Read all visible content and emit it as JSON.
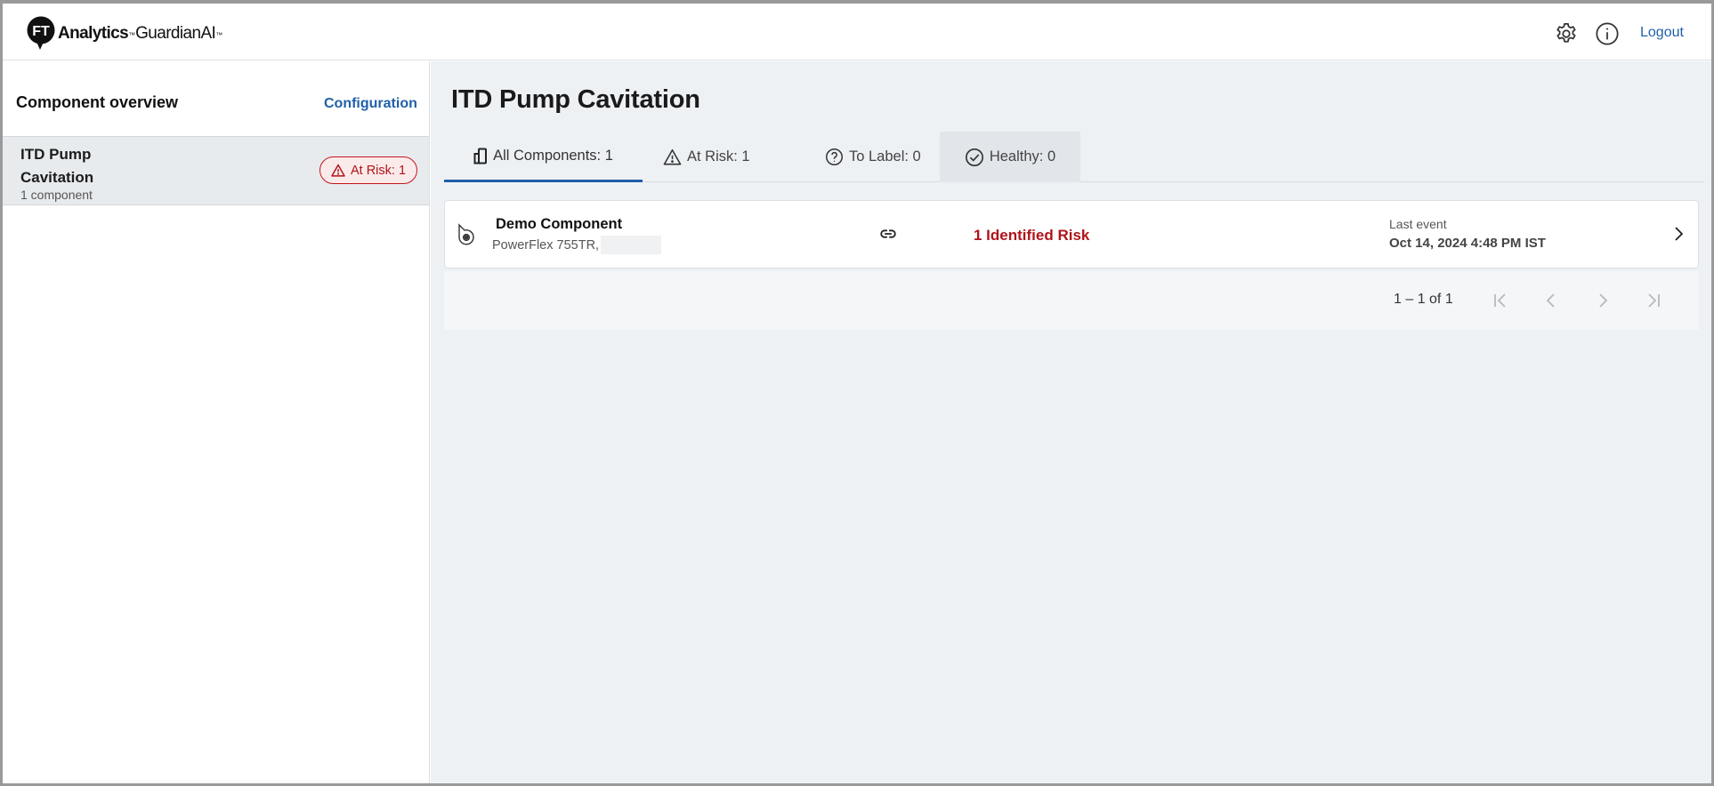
{
  "header": {
    "logo_part1": "Analytics",
    "logo_tm1": "™",
    "logo_part2": "GuardianAI",
    "logo_tm2": "™",
    "logout_label": "Logout"
  },
  "sidebar": {
    "title": "Component overview",
    "config_label": "Configuration",
    "items": [
      {
        "name": "ITD Pump Cavitation",
        "sub": "1 component",
        "risk_label": "At Risk: 1"
      }
    ]
  },
  "main": {
    "title": "ITD Pump Cavitation",
    "tabs": [
      {
        "label": "All Components: 1",
        "icon": "device-icon",
        "active": true
      },
      {
        "label": "At Risk: 1",
        "icon": "warning-icon"
      },
      {
        "label": "To Label: 0",
        "icon": "question-icon"
      },
      {
        "label": "Healthy: 0",
        "icon": "check-circle-icon"
      }
    ],
    "components": [
      {
        "name": "Demo Component",
        "sub": "PowerFlex 755TR,",
        "risk": "1 Identified Risk",
        "last_event_label": "Last event",
        "last_event_value": "Oct 14, 2024 4:48 PM IST"
      }
    ],
    "pagination": {
      "range": "1 – 1 of 1"
    }
  },
  "colors": {
    "accent": "#1f5fa8",
    "danger": "#b0141a",
    "background": "#eef1f4"
  }
}
